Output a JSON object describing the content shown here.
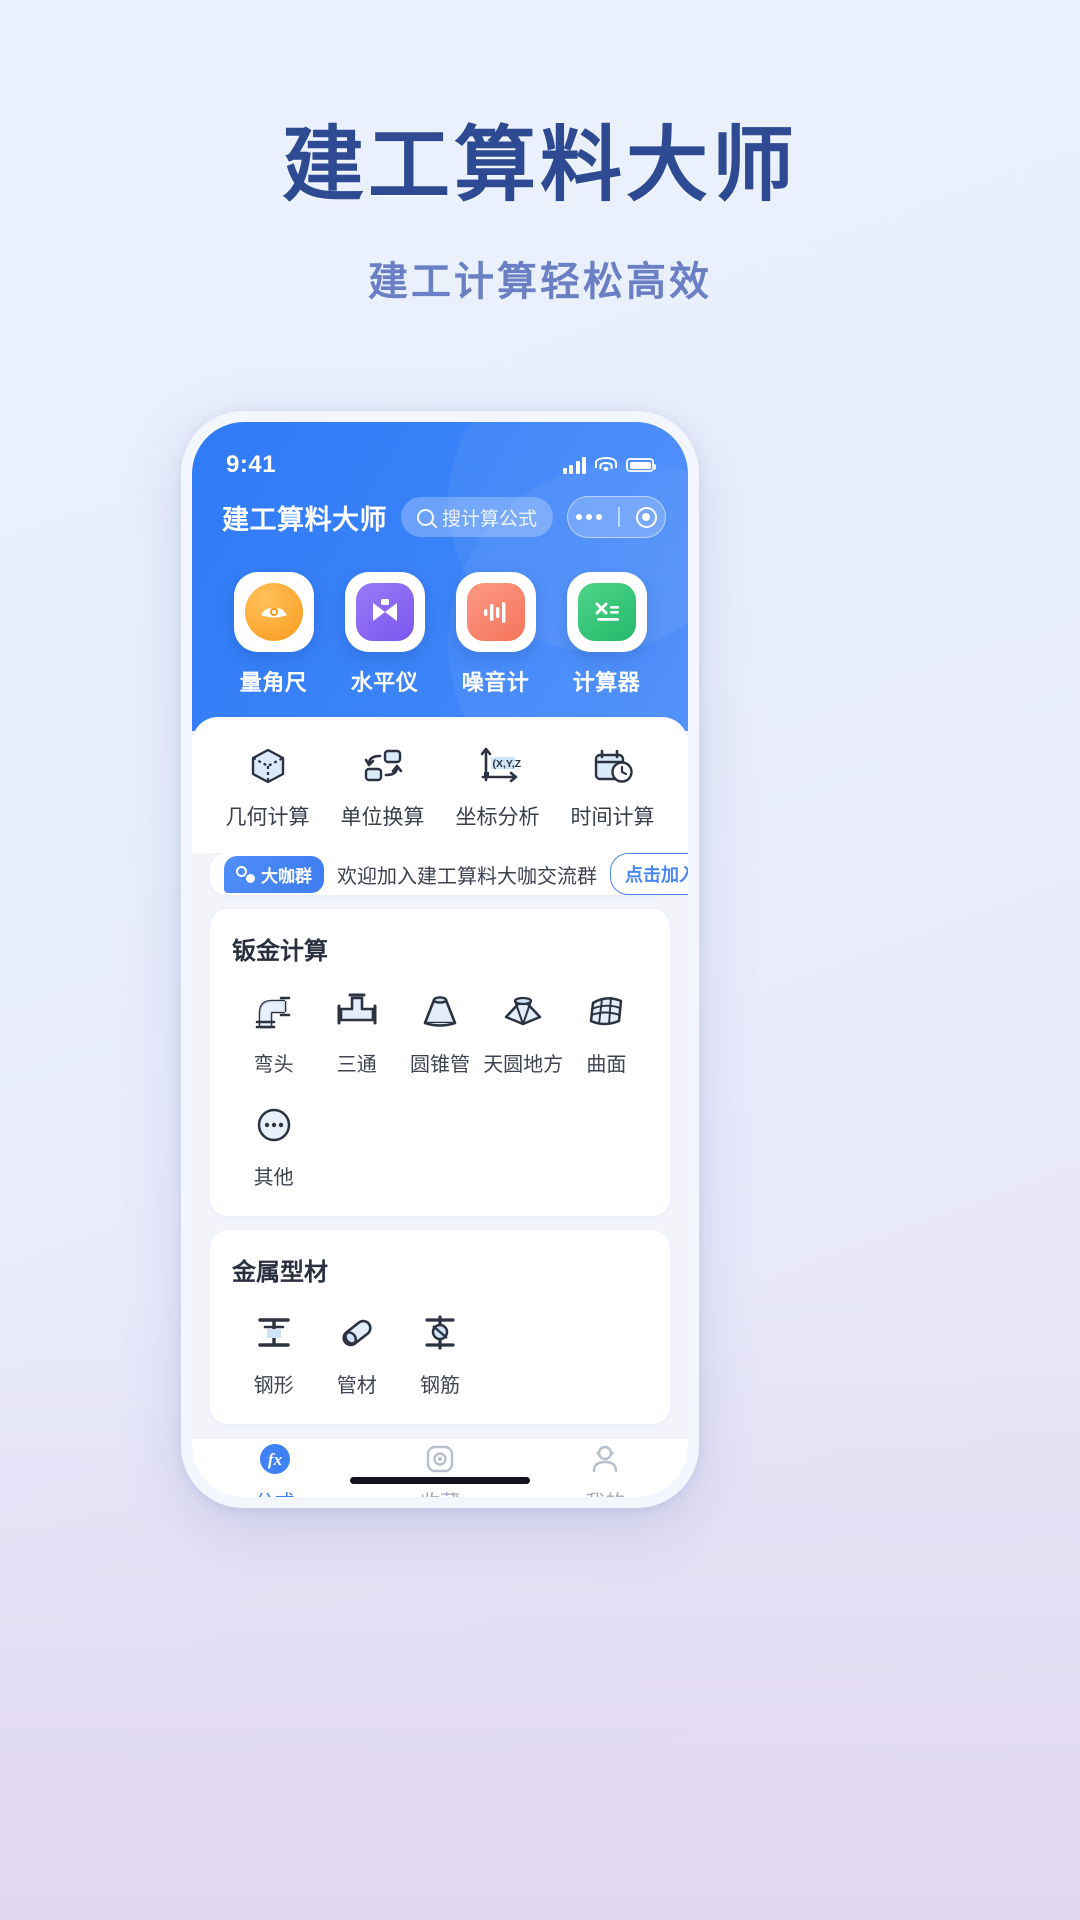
{
  "promo": {
    "title": "建工算料大师",
    "subtitle": "建工计算轻松高效",
    "title_color": "#2d4a93",
    "subtitle_color": "#6a7fc4"
  },
  "status_bar": {
    "time": "9:41",
    "signal_icon": "cellular-signal-icon",
    "wifi_icon": "wifi-icon",
    "battery_icon": "battery-icon"
  },
  "app_bar": {
    "title": "建工算料大师",
    "search_placeholder": "搜计算公式",
    "search_icon": "search-icon",
    "more_icon": "more-dots-icon",
    "target_icon": "target-icon"
  },
  "top_tools": [
    {
      "label": "量角尺",
      "icon": "protractor-icon",
      "color": "#f99a1c"
    },
    {
      "label": "水平仪",
      "icon": "level-icon",
      "color": "#7b55ee"
    },
    {
      "label": "噪音计",
      "icon": "noise-meter-icon",
      "color": "#f5735a"
    },
    {
      "label": "计算器",
      "icon": "calculator-icon",
      "color": "#24b96a"
    }
  ],
  "quick_tools": [
    {
      "label": "几何计算",
      "icon": "cube-icon"
    },
    {
      "label": "单位换算",
      "icon": "unit-swap-icon"
    },
    {
      "label": "坐标分析",
      "icon": "coordinate-axes-icon",
      "axis_label": "(X,Y,Z)"
    },
    {
      "label": "时间计算",
      "icon": "calendar-clock-icon"
    }
  ],
  "banner": {
    "badge": "大咖群",
    "badge_icon": "group-chat-icon",
    "text": "欢迎加入建工算料大咖交流群",
    "button": "点击加入",
    "accent": "#4a87f3"
  },
  "sections": [
    {
      "title": "钣金计算",
      "items": [
        {
          "label": "弯头",
          "icon": "elbow-pipe-icon"
        },
        {
          "label": "三通",
          "icon": "tee-pipe-icon"
        },
        {
          "label": "圆锥管",
          "icon": "cone-pipe-icon"
        },
        {
          "label": "天圆地方",
          "icon": "square-to-round-icon"
        },
        {
          "label": "曲面",
          "icon": "curved-surface-icon"
        },
        {
          "label": "其他",
          "icon": "more-circle-icon"
        }
      ]
    },
    {
      "title": "金属型材",
      "items": [
        {
          "label": "钢形",
          "icon": "steel-beam-icon"
        },
        {
          "label": "管材",
          "icon": "tube-icon"
        },
        {
          "label": "钢筋",
          "icon": "rebar-icon"
        }
      ]
    }
  ],
  "tabbar": {
    "active_color": "#3f82f5",
    "inactive_color": "#a5abb9",
    "items": [
      {
        "label": "公式",
        "icon": "formula-fx-icon",
        "active": true
      },
      {
        "label": "收藏",
        "icon": "favorite-icon",
        "active": false
      },
      {
        "label": "我的",
        "icon": "profile-icon",
        "active": false
      }
    ]
  }
}
